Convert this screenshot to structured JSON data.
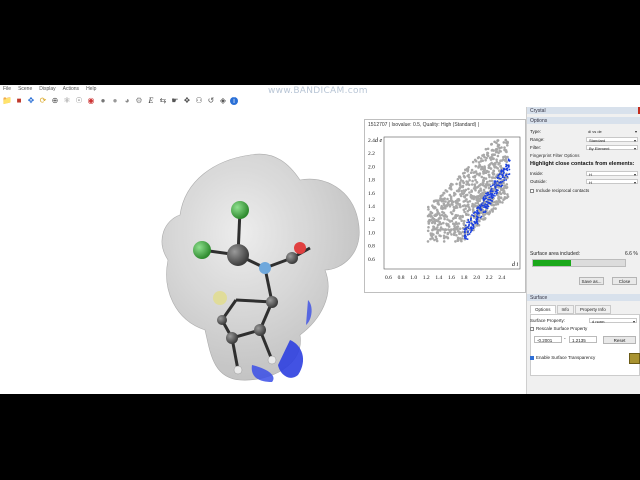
{
  "watermark": "www.BANDICAM.com",
  "menu": [
    "File",
    "Scene",
    "Display",
    "Actions",
    "Help"
  ],
  "toolbar_icons": [
    "open-folder-icon",
    "save-icon",
    "move-icon",
    "rotate-icon",
    "zoom-icon",
    "atom-icon",
    "molecule-icon",
    "surface-icon",
    "sphere-icon",
    "sphere-alt-icon",
    "globe-icon",
    "settings-icon",
    "italic-e-icon",
    "measure-icon",
    "select-icon",
    "crystal-icon",
    "hydrogen-icon",
    "reset-icon",
    "camera-icon",
    "info-icon"
  ],
  "fingerprint": {
    "title": "1512707 | Isovalue: 0.5, Quality: High (Standard) |",
    "ylabel": "d e",
    "xlabel": "d i",
    "yticks": [
      "2.4",
      "2.2",
      "2.0",
      "1.8",
      "1.6",
      "1.4",
      "1.2",
      "1.0",
      "0.8",
      "0.6"
    ],
    "xticks": [
      "0.6",
      "0.8",
      "1.0",
      "1.2",
      "1.4",
      "1.6",
      "1.8",
      "2.0",
      "2.2",
      "2.4"
    ]
  },
  "panel": {
    "crystal_header": "Crystal",
    "options_header": "Options",
    "type_label": "Type:",
    "type_value": "di vs de",
    "range_label": "Range:",
    "range_value": "Standard",
    "filter_label": "Filter:",
    "filter_value": "By Element",
    "filter_options_title": "Fingerprint Filter Options",
    "highlight_label": "Highlight close contacts from elements:",
    "inside_label": "Inside:",
    "inside_value": "H",
    "outside_label": "Outside:",
    "outside_value": "H",
    "reciprocal_label": "Include reciprocal contacts",
    "area_label": "Surface area included:",
    "area_value": "6.6 %",
    "area_fraction": 0.066,
    "save_button": "Save as...",
    "close_button": "Close",
    "surface_header": "Surface",
    "tabs": [
      "Options",
      "Info",
      "Property Info"
    ],
    "surface_property_label": "Surface Property:",
    "surface_property_value": "d norm",
    "rescale_label": "Rescale Surface Property",
    "min_value": "-0.2001",
    "max_value": "1.2135",
    "reset_button": "Reset",
    "transparency_label": "Enable Surface Transparency"
  },
  "colors": {
    "accent": "#2a6fd6",
    "fingerprint_blue": "#1a3fe0",
    "progress": "#1aa81a"
  }
}
